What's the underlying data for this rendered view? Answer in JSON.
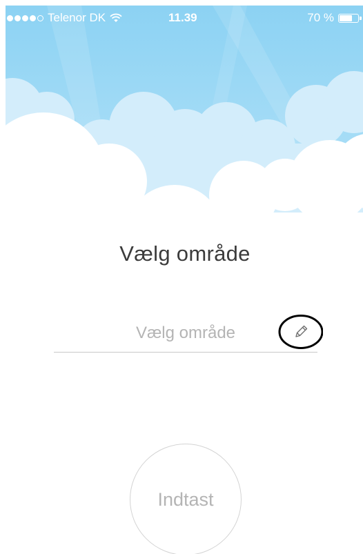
{
  "status_bar": {
    "carrier": "Telenor DK",
    "time": "11.39",
    "battery_text": "70 %",
    "battery_level": 0.7,
    "signal_bars_filled": 4,
    "signal_bars_total": 5
  },
  "main": {
    "title": "Vælg område",
    "area_input": {
      "placeholder": "Vælg område",
      "value": ""
    },
    "submit_label": "Indtast"
  },
  "icons": {
    "edit": "pencil-icon",
    "wifi": "wifi-icon",
    "battery": "battery-icon",
    "signal": "signal-dots-icon"
  },
  "colors": {
    "sky_top": "#86cff2",
    "sky_bottom": "#a9ddf6",
    "cloud_back": "#d2ecfa",
    "text_dark": "#3b3b3b",
    "text_light": "#b4b4b4"
  }
}
